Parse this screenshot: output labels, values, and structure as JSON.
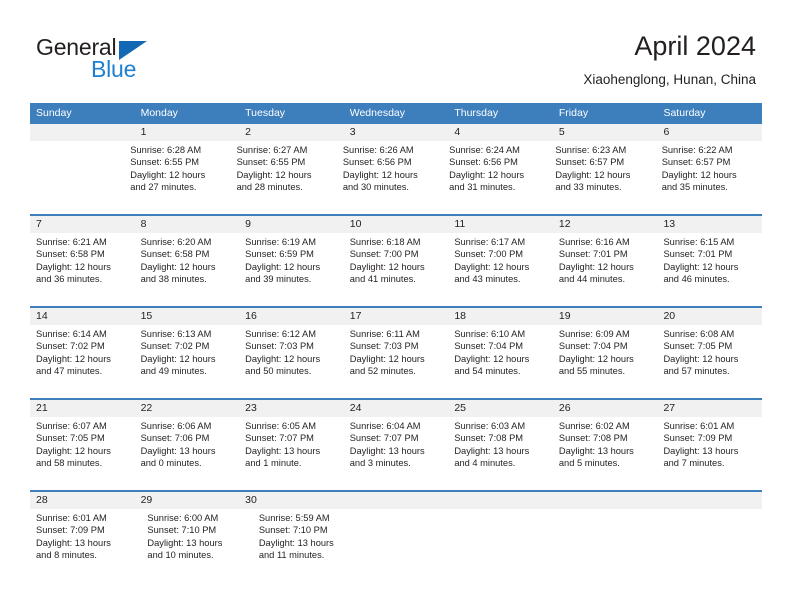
{
  "brand": {
    "name_part1": "General",
    "name_part2": "Blue",
    "triangle_icon": "triangle-icon",
    "color_dark": "#231f20",
    "color_blue": "#1f7fd1"
  },
  "header": {
    "title": "April 2024",
    "subtitle": "Xiaohenglong, Hunan, China"
  },
  "calendar": {
    "accent_color": "#3d7ebd",
    "band_color": "#f1f1f1",
    "weekdays": [
      "Sunday",
      "Monday",
      "Tuesday",
      "Wednesday",
      "Thursday",
      "Friday",
      "Saturday"
    ],
    "weeks": [
      {
        "lead_blanks": 1,
        "days": [
          {
            "date": "1",
            "sunrise": "Sunrise: 6:28 AM",
            "sunset": "Sunset: 6:55 PM",
            "daylight_1": "Daylight: 12 hours",
            "daylight_2": "and 27 minutes."
          },
          {
            "date": "2",
            "sunrise": "Sunrise: 6:27 AM",
            "sunset": "Sunset: 6:55 PM",
            "daylight_1": "Daylight: 12 hours",
            "daylight_2": "and 28 minutes."
          },
          {
            "date": "3",
            "sunrise": "Sunrise: 6:26 AM",
            "sunset": "Sunset: 6:56 PM",
            "daylight_1": "Daylight: 12 hours",
            "daylight_2": "and 30 minutes."
          },
          {
            "date": "4",
            "sunrise": "Sunrise: 6:24 AM",
            "sunset": "Sunset: 6:56 PM",
            "daylight_1": "Daylight: 12 hours",
            "daylight_2": "and 31 minutes."
          },
          {
            "date": "5",
            "sunrise": "Sunrise: 6:23 AM",
            "sunset": "Sunset: 6:57 PM",
            "daylight_1": "Daylight: 12 hours",
            "daylight_2": "and 33 minutes."
          },
          {
            "date": "6",
            "sunrise": "Sunrise: 6:22 AM",
            "sunset": "Sunset: 6:57 PM",
            "daylight_1": "Daylight: 12 hours",
            "daylight_2": "and 35 minutes."
          }
        ]
      },
      {
        "lead_blanks": 0,
        "days": [
          {
            "date": "7",
            "sunrise": "Sunrise: 6:21 AM",
            "sunset": "Sunset: 6:58 PM",
            "daylight_1": "Daylight: 12 hours",
            "daylight_2": "and 36 minutes."
          },
          {
            "date": "8",
            "sunrise": "Sunrise: 6:20 AM",
            "sunset": "Sunset: 6:58 PM",
            "daylight_1": "Daylight: 12 hours",
            "daylight_2": "and 38 minutes."
          },
          {
            "date": "9",
            "sunrise": "Sunrise: 6:19 AM",
            "sunset": "Sunset: 6:59 PM",
            "daylight_1": "Daylight: 12 hours",
            "daylight_2": "and 39 minutes."
          },
          {
            "date": "10",
            "sunrise": "Sunrise: 6:18 AM",
            "sunset": "Sunset: 7:00 PM",
            "daylight_1": "Daylight: 12 hours",
            "daylight_2": "and 41 minutes."
          },
          {
            "date": "11",
            "sunrise": "Sunrise: 6:17 AM",
            "sunset": "Sunset: 7:00 PM",
            "daylight_1": "Daylight: 12 hours",
            "daylight_2": "and 43 minutes."
          },
          {
            "date": "12",
            "sunrise": "Sunrise: 6:16 AM",
            "sunset": "Sunset: 7:01 PM",
            "daylight_1": "Daylight: 12 hours",
            "daylight_2": "and 44 minutes."
          },
          {
            "date": "13",
            "sunrise": "Sunrise: 6:15 AM",
            "sunset": "Sunset: 7:01 PM",
            "daylight_1": "Daylight: 12 hours",
            "daylight_2": "and 46 minutes."
          }
        ]
      },
      {
        "lead_blanks": 0,
        "days": [
          {
            "date": "14",
            "sunrise": "Sunrise: 6:14 AM",
            "sunset": "Sunset: 7:02 PM",
            "daylight_1": "Daylight: 12 hours",
            "daylight_2": "and 47 minutes."
          },
          {
            "date": "15",
            "sunrise": "Sunrise: 6:13 AM",
            "sunset": "Sunset: 7:02 PM",
            "daylight_1": "Daylight: 12 hours",
            "daylight_2": "and 49 minutes."
          },
          {
            "date": "16",
            "sunrise": "Sunrise: 6:12 AM",
            "sunset": "Sunset: 7:03 PM",
            "daylight_1": "Daylight: 12 hours",
            "daylight_2": "and 50 minutes."
          },
          {
            "date": "17",
            "sunrise": "Sunrise: 6:11 AM",
            "sunset": "Sunset: 7:03 PM",
            "daylight_1": "Daylight: 12 hours",
            "daylight_2": "and 52 minutes."
          },
          {
            "date": "18",
            "sunrise": "Sunrise: 6:10 AM",
            "sunset": "Sunset: 7:04 PM",
            "daylight_1": "Daylight: 12 hours",
            "daylight_2": "and 54 minutes."
          },
          {
            "date": "19",
            "sunrise": "Sunrise: 6:09 AM",
            "sunset": "Sunset: 7:04 PM",
            "daylight_1": "Daylight: 12 hours",
            "daylight_2": "and 55 minutes."
          },
          {
            "date": "20",
            "sunrise": "Sunrise: 6:08 AM",
            "sunset": "Sunset: 7:05 PM",
            "daylight_1": "Daylight: 12 hours",
            "daylight_2": "and 57 minutes."
          }
        ]
      },
      {
        "lead_blanks": 0,
        "days": [
          {
            "date": "21",
            "sunrise": "Sunrise: 6:07 AM",
            "sunset": "Sunset: 7:05 PM",
            "daylight_1": "Daylight: 12 hours",
            "daylight_2": "and 58 minutes."
          },
          {
            "date": "22",
            "sunrise": "Sunrise: 6:06 AM",
            "sunset": "Sunset: 7:06 PM",
            "daylight_1": "Daylight: 13 hours",
            "daylight_2": "and 0 minutes."
          },
          {
            "date": "23",
            "sunrise": "Sunrise: 6:05 AM",
            "sunset": "Sunset: 7:07 PM",
            "daylight_1": "Daylight: 13 hours",
            "daylight_2": "and 1 minute."
          },
          {
            "date": "24",
            "sunrise": "Sunrise: 6:04 AM",
            "sunset": "Sunset: 7:07 PM",
            "daylight_1": "Daylight: 13 hours",
            "daylight_2": "and 3 minutes."
          },
          {
            "date": "25",
            "sunrise": "Sunrise: 6:03 AM",
            "sunset": "Sunset: 7:08 PM",
            "daylight_1": "Daylight: 13 hours",
            "daylight_2": "and 4 minutes."
          },
          {
            "date": "26",
            "sunrise": "Sunrise: 6:02 AM",
            "sunset": "Sunset: 7:08 PM",
            "daylight_1": "Daylight: 13 hours",
            "daylight_2": "and 5 minutes."
          },
          {
            "date": "27",
            "sunrise": "Sunrise: 6:01 AM",
            "sunset": "Sunset: 7:09 PM",
            "daylight_1": "Daylight: 13 hours",
            "daylight_2": "and 7 minutes."
          }
        ]
      },
      {
        "lead_blanks": 0,
        "days": [
          {
            "date": "28",
            "sunrise": "Sunrise: 6:01 AM",
            "sunset": "Sunset: 7:09 PM",
            "daylight_1": "Daylight: 13 hours",
            "daylight_2": "and 8 minutes."
          },
          {
            "date": "29",
            "sunrise": "Sunrise: 6:00 AM",
            "sunset": "Sunset: 7:10 PM",
            "daylight_1": "Daylight: 13 hours",
            "daylight_2": "and 10 minutes."
          },
          {
            "date": "30",
            "sunrise": "Sunrise: 5:59 AM",
            "sunset": "Sunset: 7:10 PM",
            "daylight_1": "Daylight: 13 hours",
            "daylight_2": "and 11 minutes."
          }
        ]
      }
    ]
  }
}
